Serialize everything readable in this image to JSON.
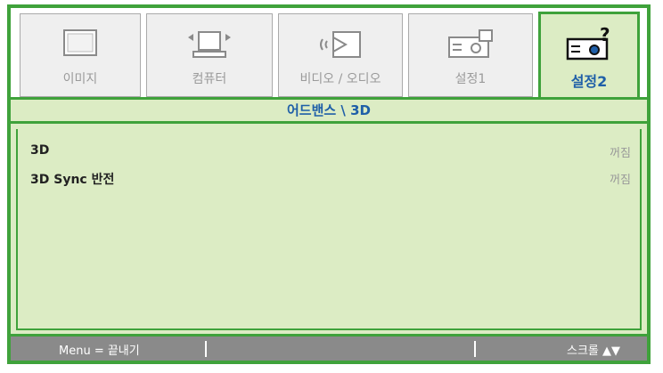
{
  "tabs": [
    {
      "label": "이미지",
      "icon": "monitor-icon",
      "active": false
    },
    {
      "label": "컴퓨터",
      "icon": "computer-icon",
      "active": false
    },
    {
      "label": "비디오 / 오디오",
      "icon": "video-audio-icon",
      "active": false
    },
    {
      "label": "설정1",
      "icon": "projector-setup-icon",
      "active": false
    },
    {
      "label": "설정2",
      "icon": "projector-help-icon",
      "active": true
    }
  ],
  "section_title": "어드밴스 \\ 3D",
  "settings": [
    {
      "label": "3D",
      "value": "꺼짐"
    },
    {
      "label": "3D Sync 반전",
      "value": "꺼짐"
    }
  ],
  "footer": {
    "exit_hint": "Menu = 끝내기",
    "scroll_hint": "스크롤 ▲▼"
  },
  "colors": {
    "frame_green": "#3fa23b",
    "panel_bg": "#dcecc4",
    "active_label_blue": "#1f5fa8",
    "footer_gray": "#8a8a8a"
  }
}
